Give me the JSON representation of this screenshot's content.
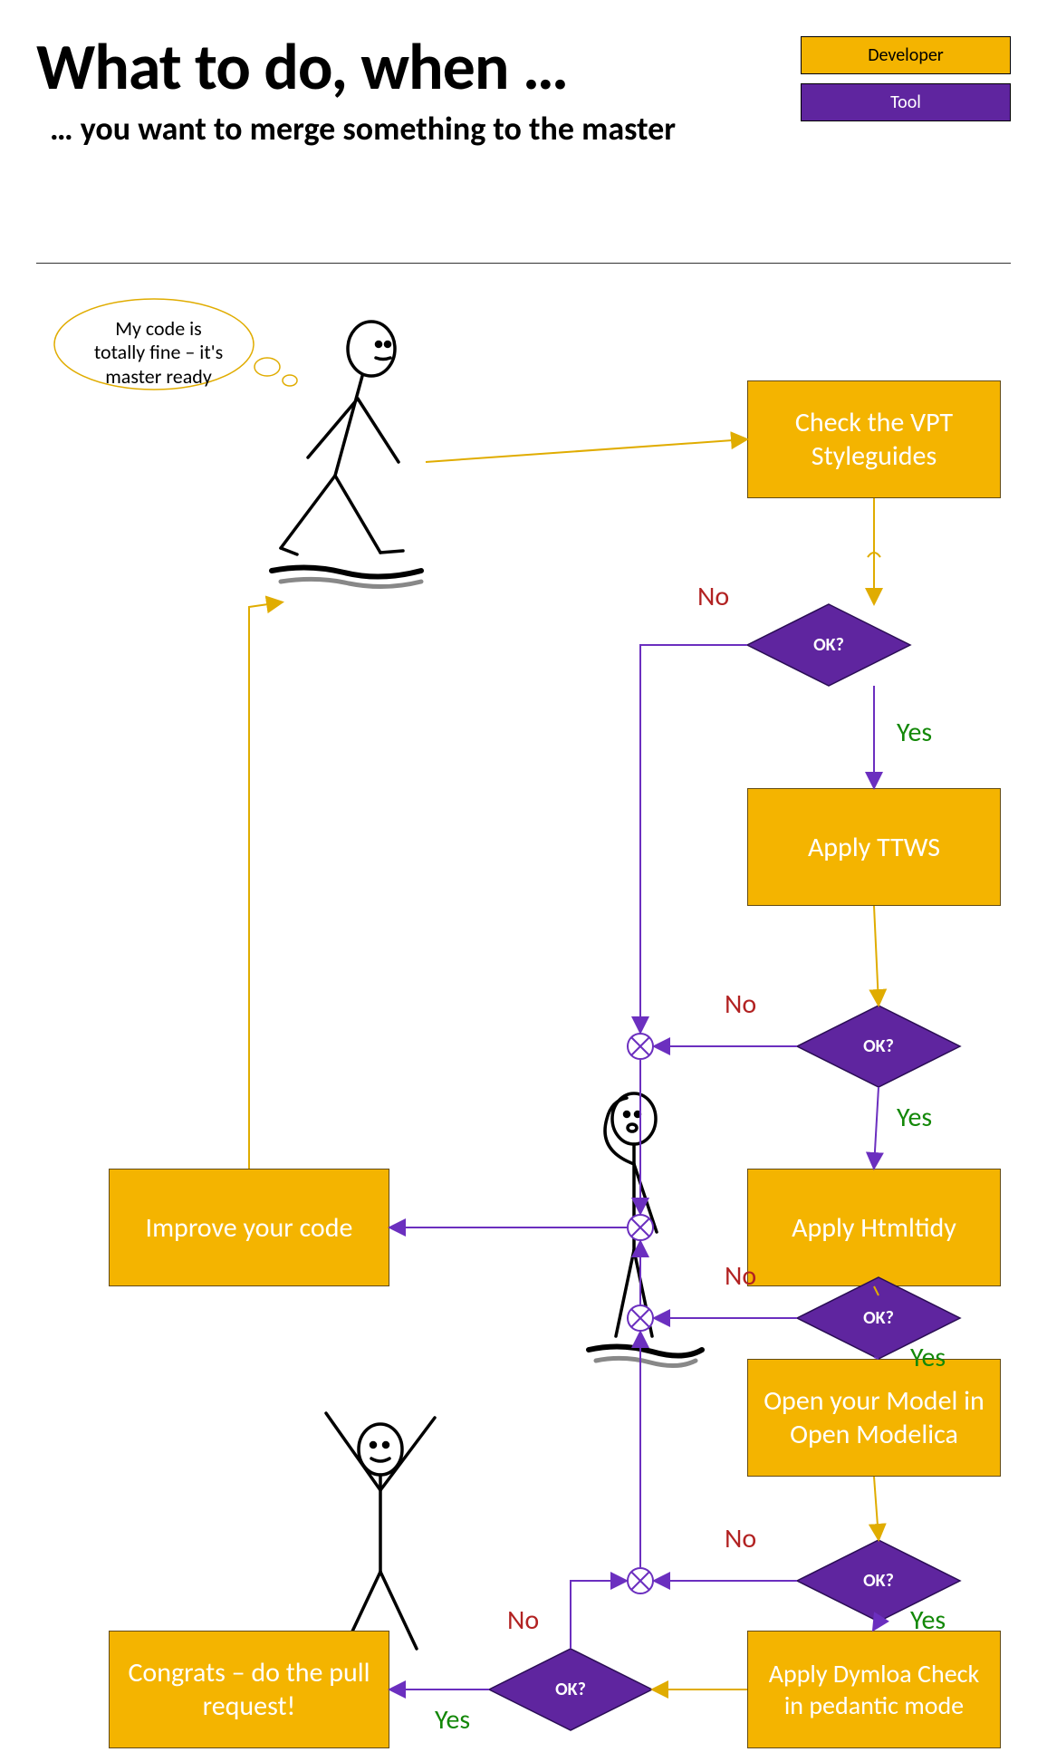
{
  "header": {
    "title": "What to do, when …",
    "subtitle": "… you want to merge something to the master"
  },
  "legend": {
    "developer": "Developer",
    "tool": "Tool"
  },
  "thought": {
    "line1": "My code is",
    "line2": "totally fine – it's",
    "line3": "master ready"
  },
  "boxes": {
    "check_style": "Check the VPT Styleguides",
    "apply_ttws": "Apply TTWS",
    "apply_htmltidy": "Apply Htmltidy",
    "open_model": "Open your Model in Open Modelica",
    "apply_dymola": "Apply Dymloa Check in pedantic mode",
    "improve": "Improve your code",
    "congrats": "Congrats –  do the pull request!"
  },
  "decision_label": "OK?",
  "labels": {
    "yes": "Yes",
    "no": "No"
  },
  "colors": {
    "developer_bg": "#F4B400",
    "tool_bg": "#5F259F",
    "line_yellow": "#E0AC00",
    "line_purple": "#6B2FBF",
    "yes": "#138808",
    "no": "#B22222"
  }
}
